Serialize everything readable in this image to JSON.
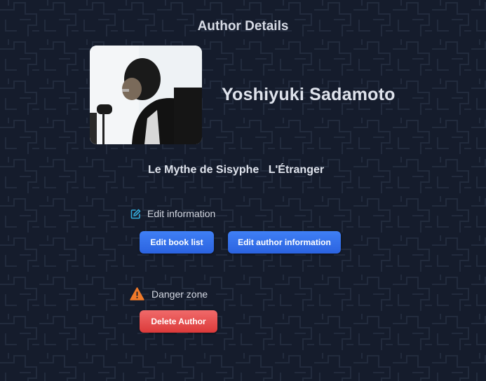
{
  "page": {
    "title": "Author Details"
  },
  "author": {
    "name": "Yoshiyuki Sadamoto",
    "photo_alt": "author-photo"
  },
  "books": [
    "Le Mythe de Sisyphe",
    "L'Étranger"
  ],
  "edit_section": {
    "label": "Edit information",
    "icon": "edit-icon",
    "buttons": {
      "book_list": "Edit book list",
      "author_info": "Edit author information"
    }
  },
  "danger_section": {
    "label": "Danger zone",
    "icon": "warning-icon",
    "buttons": {
      "delete": "Delete Author"
    }
  },
  "colors": {
    "background": "#151c2c",
    "primary_button": "#2f6bea",
    "danger_button": "#e24a4a",
    "warning_icon": "#f07a2a",
    "edit_icon": "#34a9d8"
  }
}
